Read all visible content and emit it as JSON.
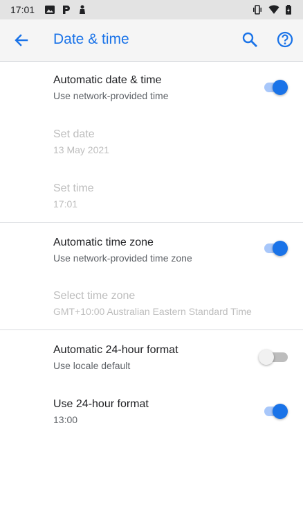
{
  "status_bar": {
    "time": "17:01",
    "icons_left": [
      "image-icon",
      "parking-icon",
      "badge-icon"
    ],
    "icons_right": [
      "vibrate-icon",
      "wifi-icon",
      "battery-icon"
    ]
  },
  "app_bar": {
    "title": "Date & time",
    "back_icon": "arrow-back-icon",
    "search_icon": "search-icon",
    "help_icon": "help-icon"
  },
  "settings": {
    "auto_datetime": {
      "title": "Automatic date & time",
      "summary": "Use network-provided time",
      "enabled": true
    },
    "set_date": {
      "title": "Set date",
      "summary": "13 May 2021"
    },
    "set_time": {
      "title": "Set time",
      "summary": "17:01"
    },
    "auto_timezone": {
      "title": "Automatic time zone",
      "summary": "Use network-provided time zone",
      "enabled": true
    },
    "select_timezone": {
      "title": "Select time zone",
      "summary": "GMT+10:00 Australian Eastern Standard Time"
    },
    "auto_24h": {
      "title": "Automatic 24-hour format",
      "summary": "Use locale default",
      "enabled": false
    },
    "use_24h": {
      "title": "Use 24-hour format",
      "summary": "13:00",
      "enabled": true
    }
  },
  "colors": {
    "accent": "#1a73e8",
    "switch_track_on": "#a8c7fa",
    "disabled_text": "#bdbdbd"
  }
}
